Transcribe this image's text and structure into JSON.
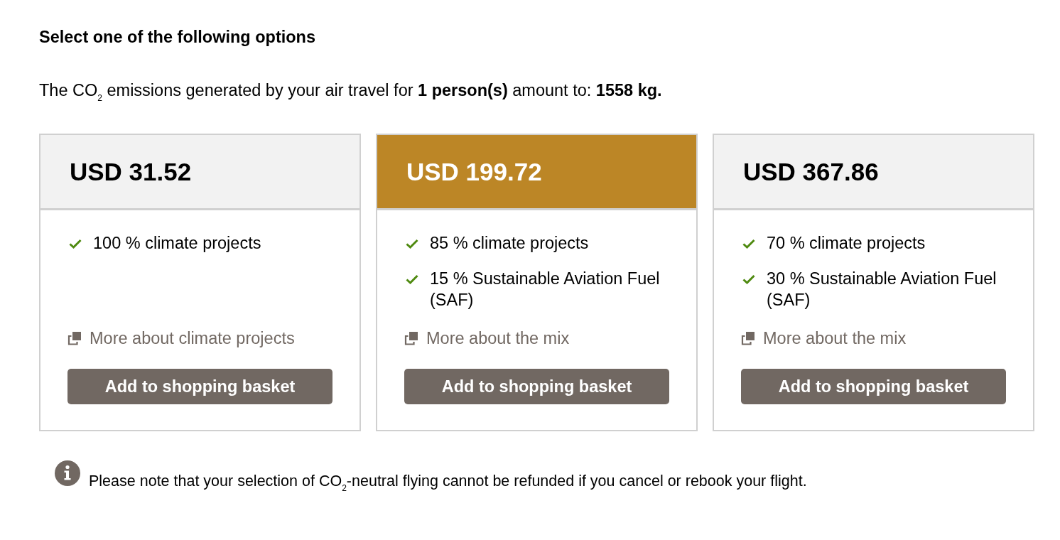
{
  "heading": "Select one of the following options",
  "summary": "The CO$_{2}$ emissions generated by your air travel for **1 person(s)** amount to: **1558 kg.**",
  "options": [
    {
      "price": "USD 31.52",
      "selected": false,
      "features": [
        "100 % climate projects"
      ],
      "link": "More about climate projects",
      "button": "Add to shopping basket"
    },
    {
      "price": "USD 199.72",
      "selected": true,
      "features": [
        "85 % climate projects",
        "15 % Sustainable Aviation Fuel (SAF)"
      ],
      "link": "More about the mix",
      "button": "Add to shopping basket"
    },
    {
      "price": "USD 367.86",
      "selected": false,
      "features": [
        "70 % climate projects",
        "30 % Sustainable Aviation Fuel (SAF)"
      ],
      "link": "More about the mix",
      "button": "Add to shopping basket"
    }
  ],
  "note": "Please note that your selection of CO$_{2}$-neutral flying cannot be refunded if you cancel or rebook your flight."
}
